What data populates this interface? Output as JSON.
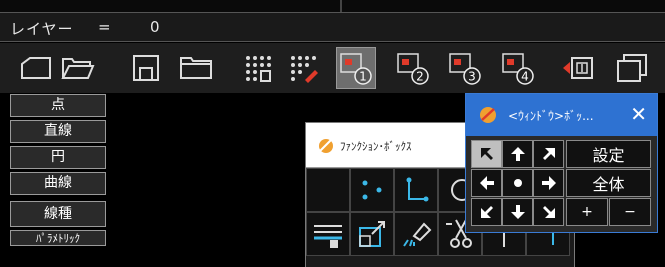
{
  "layer_bar": {
    "label": "レイヤー",
    "equals": "=",
    "value": "0"
  },
  "toolbar": {
    "icons": [
      "new-file-icon",
      "open-folder-icon",
      "save-icon",
      "folder-icon",
      "grid-select-icon",
      "grid-erase-icon",
      "layer-1-icon",
      "layer-2-icon",
      "layer-3-icon",
      "layer-4-icon",
      "layer-manage-icon",
      "window-icon"
    ],
    "active_index": 6
  },
  "commands": [
    "点",
    "直線",
    "円",
    "曲線",
    "線種",
    "ﾊﾟﾗﾒﾄﾘｯｸ"
  ],
  "function_box": {
    "title": "ﾌｧﾝｸｼｮﾝ･ﾎﾞｯｸｽ"
  },
  "window_box": {
    "title": "<ｳｨﾝﾄﾞｳ>ﾎﾞｯ...",
    "close": "✕",
    "setting": "設定",
    "all": "全体",
    "plus": "+",
    "minus": "−"
  },
  "colors": {
    "accent": "#2e72d2",
    "orange": "#f0a030",
    "red": "#e03a2a",
    "cyan": "#3bb8e8"
  }
}
